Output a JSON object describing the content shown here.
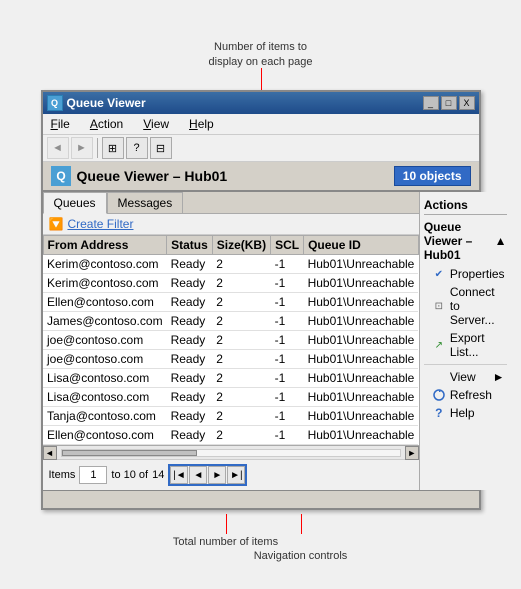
{
  "annotations": {
    "top_text": "Number of items to\ndisplay on each page"
  },
  "window": {
    "title": "Queue Viewer",
    "controls": [
      "_",
      "□",
      "X"
    ]
  },
  "menu": {
    "items": [
      "File",
      "Action",
      "View",
      "Help"
    ]
  },
  "toolbar": {
    "buttons": [
      "◄",
      "►",
      "⊞",
      "?",
      "⊟"
    ]
  },
  "content_header": {
    "title": "Queue Viewer – Hub01",
    "objects_badge": "10 objects"
  },
  "tabs": [
    "Queues",
    "Messages"
  ],
  "filter": {
    "label": "Create Filter"
  },
  "table": {
    "columns": [
      "From Address",
      "Status",
      "Size(KB)",
      "SCL",
      "Queue ID"
    ],
    "rows": [
      [
        "Kerim@contoso.com",
        "Ready",
        "2",
        "-1",
        "Hub01\\Unreachable"
      ],
      [
        "Kerim@contoso.com",
        "Ready",
        "2",
        "-1",
        "Hub01\\Unreachable"
      ],
      [
        "Ellen@contoso.com",
        "Ready",
        "2",
        "-1",
        "Hub01\\Unreachable"
      ],
      [
        "James@contoso.com",
        "Ready",
        "2",
        "-1",
        "Hub01\\Unreachable"
      ],
      [
        "joe@contoso.com",
        "Ready",
        "2",
        "-1",
        "Hub01\\Unreachable"
      ],
      [
        "joe@contoso.com",
        "Ready",
        "2",
        "-1",
        "Hub01\\Unreachable"
      ],
      [
        "Lisa@contoso.com",
        "Ready",
        "2",
        "-1",
        "Hub01\\Unreachable"
      ],
      [
        "Lisa@contoso.com",
        "Ready",
        "2",
        "-1",
        "Hub01\\Unreachable"
      ],
      [
        "Tanja@contoso.com",
        "Ready",
        "2",
        "-1",
        "Hub01\\Unreachable"
      ],
      [
        "Ellen@contoso.com",
        "Ready",
        "2",
        "-1",
        "Hub01\\Unreachable"
      ]
    ]
  },
  "pagination": {
    "items_label": "Items",
    "from_value": "1",
    "to_text": "to 10 of",
    "total": "14",
    "nav_buttons": [
      "|◄",
      "◄",
      "►",
      "►|"
    ]
  },
  "actions": {
    "panel_title": "Actions",
    "section_title": "Queue Viewer – Hub01",
    "items": [
      {
        "label": "Properties",
        "icon": "✔",
        "icon_color": "#316ac5"
      },
      {
        "label": "Connect to Server...",
        "icon": "⊡",
        "icon_color": "#666"
      },
      {
        "label": "Export List...",
        "icon": "↗",
        "icon_color": "#2a8a2a"
      },
      {
        "label": "View",
        "has_submenu": true,
        "icon": "",
        "icon_color": ""
      },
      {
        "label": "Refresh",
        "icon": "↻",
        "icon_color": "#316ac5"
      },
      {
        "label": "Help",
        "icon": "?",
        "icon_color": "#316ac5"
      }
    ]
  },
  "bottom_annotations": {
    "total_label": "Total number of items",
    "nav_label": "Navigation controls"
  }
}
